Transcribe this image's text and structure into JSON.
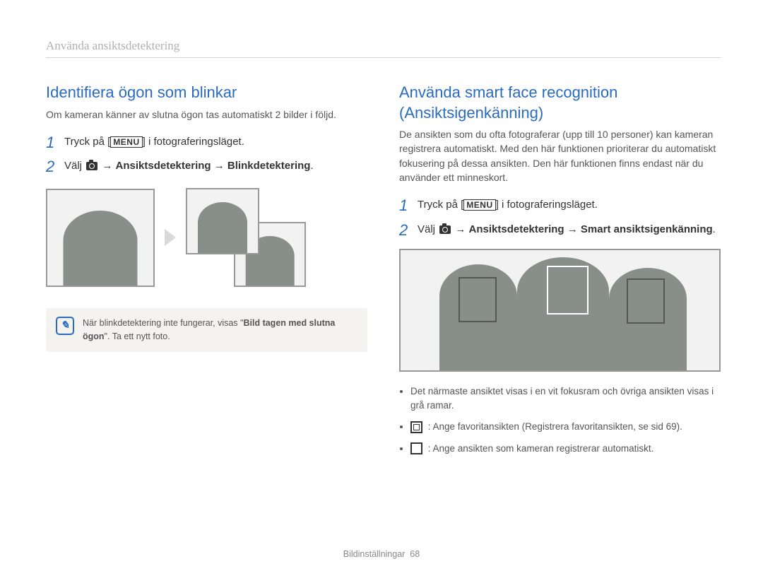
{
  "breadcrumb": "Använda ansiktsdetektering",
  "left": {
    "heading": "Identifiera ögon som blinkar",
    "intro": "Om kameran känner av slutna ögon tas automatiskt 2 bilder i följd.",
    "step1_prefix": "Tryck på [",
    "menu_label": "MENU",
    "step1_suffix": "] i fotograferingsläget.",
    "step2_prefix": "Välj ",
    "step2_arrow1": " → ",
    "step2_bold1": "Ansiktsdetektering",
    "step2_arrow2": " → ",
    "step2_bold2": "Blinkdetektering",
    "step2_period": ".",
    "note_prefix": "När blinkdetektering inte fungerar, visas \"",
    "note_quoted": "Bild tagen med slutna ögon",
    "note_suffix": "\". Ta ett nytt foto.",
    "note_icon_glyph": "✎"
  },
  "right": {
    "heading": "Använda smart face recognition (Ansiktsigenkänning)",
    "intro": "De ansikten som du ofta fotograferar (upp till 10 personer) kan kameran registrera automatiskt. Med den här funktionen prioriterar du automatiskt fokusering på dessa ansikten. Den här funktionen finns endast när du använder ett minneskort.",
    "step1_prefix": "Tryck på [",
    "menu_label": "MENU",
    "step1_suffix": "] i fotograferingsläget.",
    "step2_prefix": "Välj ",
    "step2_arrow1": " → ",
    "step2_bold1": "Ansiktsdetektering",
    "step2_arrow2": " → ",
    "step2_bold2": "Smart ansiktsigenkänning",
    "step2_period": ".",
    "bullet1": "Det närmaste ansiktet visas i en vit fokusram och övriga ansikten visas i grå ramar.",
    "bullet2": " : Ange favoritansikten (Registrera favoritansikten, se sid 69).",
    "bullet3": " : Ange ansikten som kameran registrerar automatiskt."
  },
  "footer_label": "Bildinställningar",
  "footer_page": "68"
}
